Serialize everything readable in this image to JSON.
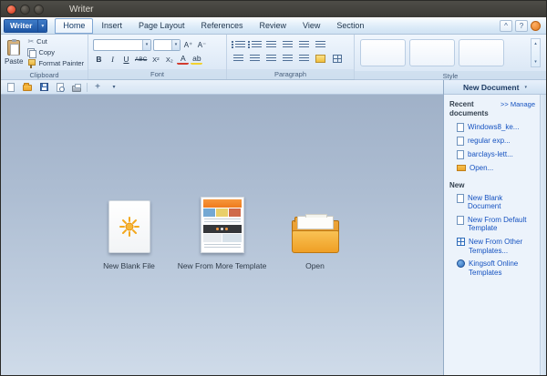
{
  "colors": {
    "accent_blue": "#1552c0",
    "titlebar_bg": "#3b3a36",
    "folder_orange": "#efa025",
    "app_button_blue": "#1d55a4"
  },
  "icons": {
    "dropdown": "▾",
    "scissors": "✂",
    "plus": "+",
    "collapse": "^",
    "help": "?",
    "up": "▴",
    "down": "▾"
  },
  "window": {
    "title": "Writer"
  },
  "menubar": {
    "app_button": "Writer",
    "tabs": [
      {
        "label": "Home"
      },
      {
        "label": "Insert"
      },
      {
        "label": "Page Layout"
      },
      {
        "label": "References"
      },
      {
        "label": "Review"
      },
      {
        "label": "View"
      },
      {
        "label": "Section"
      }
    ]
  },
  "ribbon": {
    "clipboard": {
      "label": "Clipboard",
      "paste": "Paste",
      "cut": "Cut",
      "copy": "Copy",
      "format_painter": "Format Painter"
    },
    "font": {
      "label": "Font",
      "grow": "A⁺",
      "shrink": "A⁻",
      "bold": "B",
      "italic": "I",
      "underline": "U",
      "strike": "ABC",
      "superscript": "X²",
      "subscript": "X₂",
      "font_color": "A",
      "highlight": "ab"
    },
    "paragraph": {
      "label": "Paragraph"
    },
    "style": {
      "label": "Style"
    }
  },
  "launcher": {
    "items": [
      {
        "label": "New Blank File"
      },
      {
        "label": "New From More Template"
      },
      {
        "label": "Open"
      }
    ]
  },
  "sidebar": {
    "header": "New Document",
    "recent": {
      "title": "Recent documents",
      "manage_link": ">> Manage",
      "items": [
        {
          "label": "Windows8_ke..."
        },
        {
          "label": "regular exp..."
        },
        {
          "label": "barclays-lett..."
        },
        {
          "label": "Open..."
        }
      ]
    },
    "new_section": {
      "title": "New",
      "items": [
        {
          "label": "New Blank Document"
        },
        {
          "label": "New From Default Template"
        },
        {
          "label": "New From Other Templates..."
        },
        {
          "label": "Kingsoft Online Templates"
        }
      ]
    }
  }
}
